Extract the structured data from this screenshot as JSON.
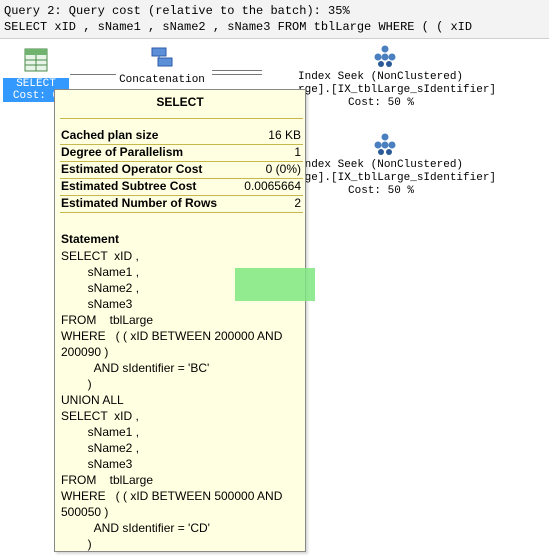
{
  "header": {
    "line1": "Query 2: Query cost (relative to the batch): 35%",
    "line2": "SELECT xID , sName1 , sName2 , sName3 FROM tblLarge WHERE ( ( xID"
  },
  "plan": {
    "select_node": {
      "label": "SELECT",
      "cost": "Cost: 0"
    },
    "concat_node": {
      "label": "Concatenation"
    },
    "seek_nodes": [
      {
        "line1": "Index Seek (NonClustered)",
        "line2": "rge].[IX_tblLarge_sIdentifier]",
        "cost": "Cost: 50 %"
      },
      {
        "line1": "Index Seek (NonClustered)",
        "line2": "rge].[IX_tblLarge_sIdentifier]",
        "cost": "Cost: 50 %"
      }
    ]
  },
  "tooltip": {
    "title": "SELECT",
    "rows": [
      {
        "label": "Cached plan size",
        "value": "16 KB"
      },
      {
        "label": "Degree of Parallelism",
        "value": "1"
      },
      {
        "label": "Estimated Operator Cost",
        "value": "0 (0%)"
      },
      {
        "label": "Estimated Subtree Cost",
        "value": "0.0065664"
      },
      {
        "label": "Estimated Number of Rows",
        "value": "2"
      }
    ],
    "statement_title": "Statement",
    "statement_text": "SELECT  xID ,\n        sName1 ,\n        sName2 ,\n        sName3\nFROM    tblLarge\nWHERE   ( ( xID BETWEEN 200000 AND\n200090 )\n          AND sIdentifier = 'BC'\n        )\nUNION ALL\nSELECT  xID ,\n        sName1 ,\n        sName2 ,\n        sName3\nFROM    tblLarge\nWHERE   ( ( xID BETWEEN 500000 AND\n500050 )\n          AND sIdentifier = 'CD'\n        )",
    "highlight_color": "#7fe87f"
  }
}
